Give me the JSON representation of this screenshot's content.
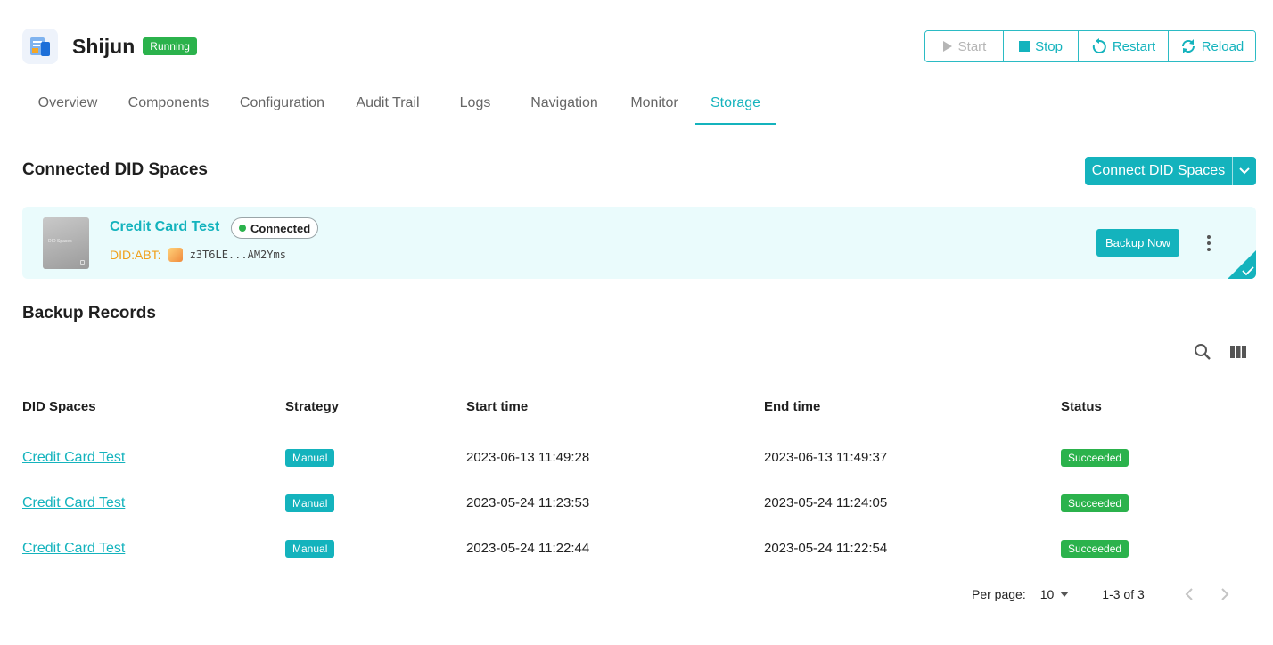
{
  "app": {
    "name": "Shijun",
    "status": "Running"
  },
  "controls": {
    "start": "Start",
    "stop": "Stop",
    "restart": "Restart",
    "reload": "Reload"
  },
  "tabs": [
    {
      "label": "Overview"
    },
    {
      "label": "Components"
    },
    {
      "label": "Configuration"
    },
    {
      "label": "Audit Trail"
    },
    {
      "label": "Logs"
    },
    {
      "label": "Navigation"
    },
    {
      "label": "Monitor"
    },
    {
      "label": "Storage",
      "active": true
    }
  ],
  "connected": {
    "title": "Connected DID Spaces",
    "connect_button": "Connect DID Spaces",
    "space": {
      "thumb_text": "DID Spaces",
      "name": "Credit Card Test",
      "status": "Connected",
      "did_label": "DID:ABT:",
      "did_value": "z3T6LE...AM2Yms",
      "backup_button": "Backup Now"
    }
  },
  "records": {
    "title": "Backup Records",
    "columns": [
      "DID Spaces",
      "Strategy",
      "Start time",
      "End time",
      "Status"
    ],
    "rows": [
      {
        "space": "Credit Card Test",
        "strategy": "Manual",
        "start": "2023-06-13 11:49:28",
        "end": "2023-06-13 11:49:37",
        "status": "Succeeded"
      },
      {
        "space": "Credit Card Test",
        "strategy": "Manual",
        "start": "2023-05-24 11:23:53",
        "end": "2023-05-24 11:24:05",
        "status": "Succeeded"
      },
      {
        "space": "Credit Card Test",
        "strategy": "Manual",
        "start": "2023-05-24 11:22:44",
        "end": "2023-05-24 11:22:54",
        "status": "Succeeded"
      }
    ]
  },
  "pagination": {
    "per_page_label": "Per page:",
    "per_page_value": "10",
    "range": "1-3 of 3"
  },
  "colors": {
    "accent": "#14b3bd",
    "success": "#2bb24c",
    "did_label": "#f0a01a",
    "card_bg": "#eafbfc"
  },
  "icons": [
    "app-logo-icon",
    "play-icon",
    "stop-icon",
    "restart-icon",
    "reload-icon",
    "chevron-down-icon",
    "more-vert-icon",
    "check-icon",
    "search-icon",
    "columns-icon",
    "arrow-drop-down-icon",
    "chevron-left-icon",
    "chevron-right-icon"
  ]
}
